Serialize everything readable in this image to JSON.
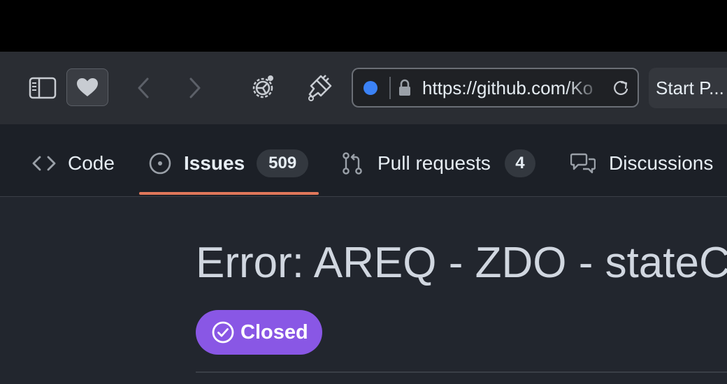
{
  "browser": {
    "url": "https://github.com/Ko",
    "start_tab_label": "Start P..."
  },
  "repo_nav": {
    "tabs": [
      {
        "label": "Code",
        "icon": "code-icon"
      },
      {
        "label": "Issues",
        "icon": "issue-opened-icon",
        "count": "509",
        "selected": true
      },
      {
        "label": "Pull requests",
        "icon": "git-pull-request-icon",
        "count": "4"
      },
      {
        "label": "Discussions",
        "icon": "comment-discussion-icon"
      }
    ]
  },
  "issue": {
    "title": "Error: AREQ - ZDO - stateCh",
    "state_label": "Closed"
  },
  "colors": {
    "selected_underline": "#e0775a",
    "closed_badge": "#8957e5",
    "url_dot": "#3b82f6"
  }
}
